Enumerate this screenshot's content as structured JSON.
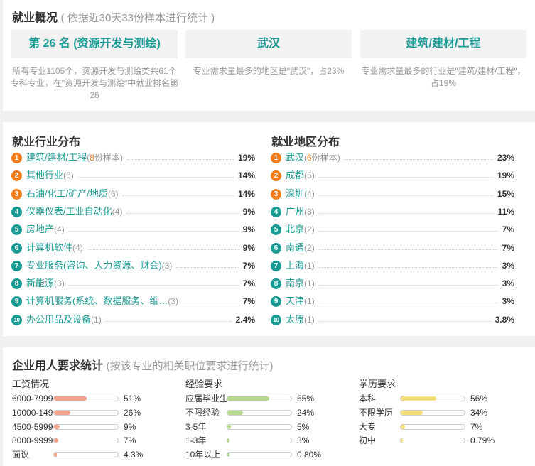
{
  "overview": {
    "title": "就业概况",
    "subtitle": "( 依据近30天33份样本进行统计 )",
    "boxes": [
      {
        "value": "第 26 名 (资源开发与测绘)",
        "desc": "所有专业1105个，资源开发与测绘类共61个专科专业，在\"资源开发与测绘\"中就业排名第26"
      },
      {
        "value": "武汉",
        "desc": "专业需求量最多的地区是\"武汉\"，占23%"
      },
      {
        "value": "建筑/建材/工程",
        "desc": "专业需求量最多的行业是\"建筑/建材/工程\"，占19%"
      }
    ]
  },
  "industry": {
    "title": "就业行业分布",
    "sample_suffix": "份样本",
    "items": [
      {
        "rank": "1",
        "name": "建筑/建材/工程",
        "count": "8",
        "pct": "19%"
      },
      {
        "rank": "2",
        "name": "其他行业",
        "count": "6",
        "pct": "14%"
      },
      {
        "rank": "3",
        "name": "石油/化工/矿产/地质",
        "count": "6",
        "pct": "14%"
      },
      {
        "rank": "4",
        "name": "仪器仪表/工业自动化",
        "count": "4",
        "pct": "9%"
      },
      {
        "rank": "5",
        "name": "房地产",
        "count": "4",
        "pct": "9%"
      },
      {
        "rank": "6",
        "name": "计算机软件",
        "count": "4",
        "pct": "9%"
      },
      {
        "rank": "7",
        "name": "专业服务(咨询、人力资源、财会)",
        "count": "3",
        "pct": "7%"
      },
      {
        "rank": "8",
        "name": "新能源",
        "count": "3",
        "pct": "7%"
      },
      {
        "rank": "9",
        "name": "计算机服务(系统、数据服务、维…",
        "count": "3",
        "pct": "7%"
      },
      {
        "rank": "10",
        "name": "办公用品及设备",
        "count": "1",
        "pct": "2.4%"
      }
    ]
  },
  "region": {
    "title": "就业地区分布",
    "sample_suffix": "份样本",
    "items": [
      {
        "rank": "1",
        "name": "武汉",
        "count": "6",
        "pct": "23%"
      },
      {
        "rank": "2",
        "name": "成都",
        "count": "5",
        "pct": "19%"
      },
      {
        "rank": "3",
        "name": "深圳",
        "count": "4",
        "pct": "15%"
      },
      {
        "rank": "4",
        "name": "广州",
        "count": "3",
        "pct": "11%"
      },
      {
        "rank": "5",
        "name": "北京",
        "count": "2",
        "pct": "7%"
      },
      {
        "rank": "6",
        "name": "南通",
        "count": "2",
        "pct": "7%"
      },
      {
        "rank": "7",
        "name": "上海",
        "count": "1",
        "pct": "3%"
      },
      {
        "rank": "8",
        "name": "南京",
        "count": "1",
        "pct": "3%"
      },
      {
        "rank": "9",
        "name": "天津",
        "count": "1",
        "pct": "3%"
      },
      {
        "rank": "10",
        "name": "太原",
        "count": "1",
        "pct": "3.8%"
      }
    ]
  },
  "requirements": {
    "title": "企业用人要求统计",
    "subtitle": "(按该专业的相关职位要求进行统计)",
    "salary": {
      "heading": "工资情况",
      "items": [
        {
          "label": "6000-7999",
          "pct": "51%",
          "fill": 51
        },
        {
          "label": "10000-149",
          "pct": "26%",
          "fill": 26
        },
        {
          "label": "4500-5999",
          "pct": "9%",
          "fill": 9
        },
        {
          "label": "8000-9999",
          "pct": "7%",
          "fill": 7
        },
        {
          "label": "面议",
          "pct": "4.3%",
          "fill": 4.3
        }
      ]
    },
    "experience": {
      "heading": "经验要求",
      "items": [
        {
          "label": "应届毕业生",
          "pct": "65%",
          "fill": 65
        },
        {
          "label": "不限经验",
          "pct": "24%",
          "fill": 24
        },
        {
          "label": "3-5年",
          "pct": "5%",
          "fill": 5
        },
        {
          "label": "1-3年",
          "pct": "3%",
          "fill": 3
        },
        {
          "label": "10年以上",
          "pct": "0.80%",
          "fill": 0.8
        }
      ]
    },
    "education": {
      "heading": "学历要求",
      "items": [
        {
          "label": "本科",
          "pct": "56%",
          "fill": 56
        },
        {
          "label": "不限学历",
          "pct": "34%",
          "fill": 34
        },
        {
          "label": "大专",
          "pct": "7%",
          "fill": 7
        },
        {
          "label": "初中",
          "pct": "0.79%",
          "fill": 0.79
        }
      ]
    }
  },
  "colors": {
    "accent": "#1a9b93",
    "rank_top": "#f07c1b",
    "salary_bar": "#f2a38c",
    "experience_bar": "#b6d990",
    "education_bar": "#f5e07a"
  }
}
